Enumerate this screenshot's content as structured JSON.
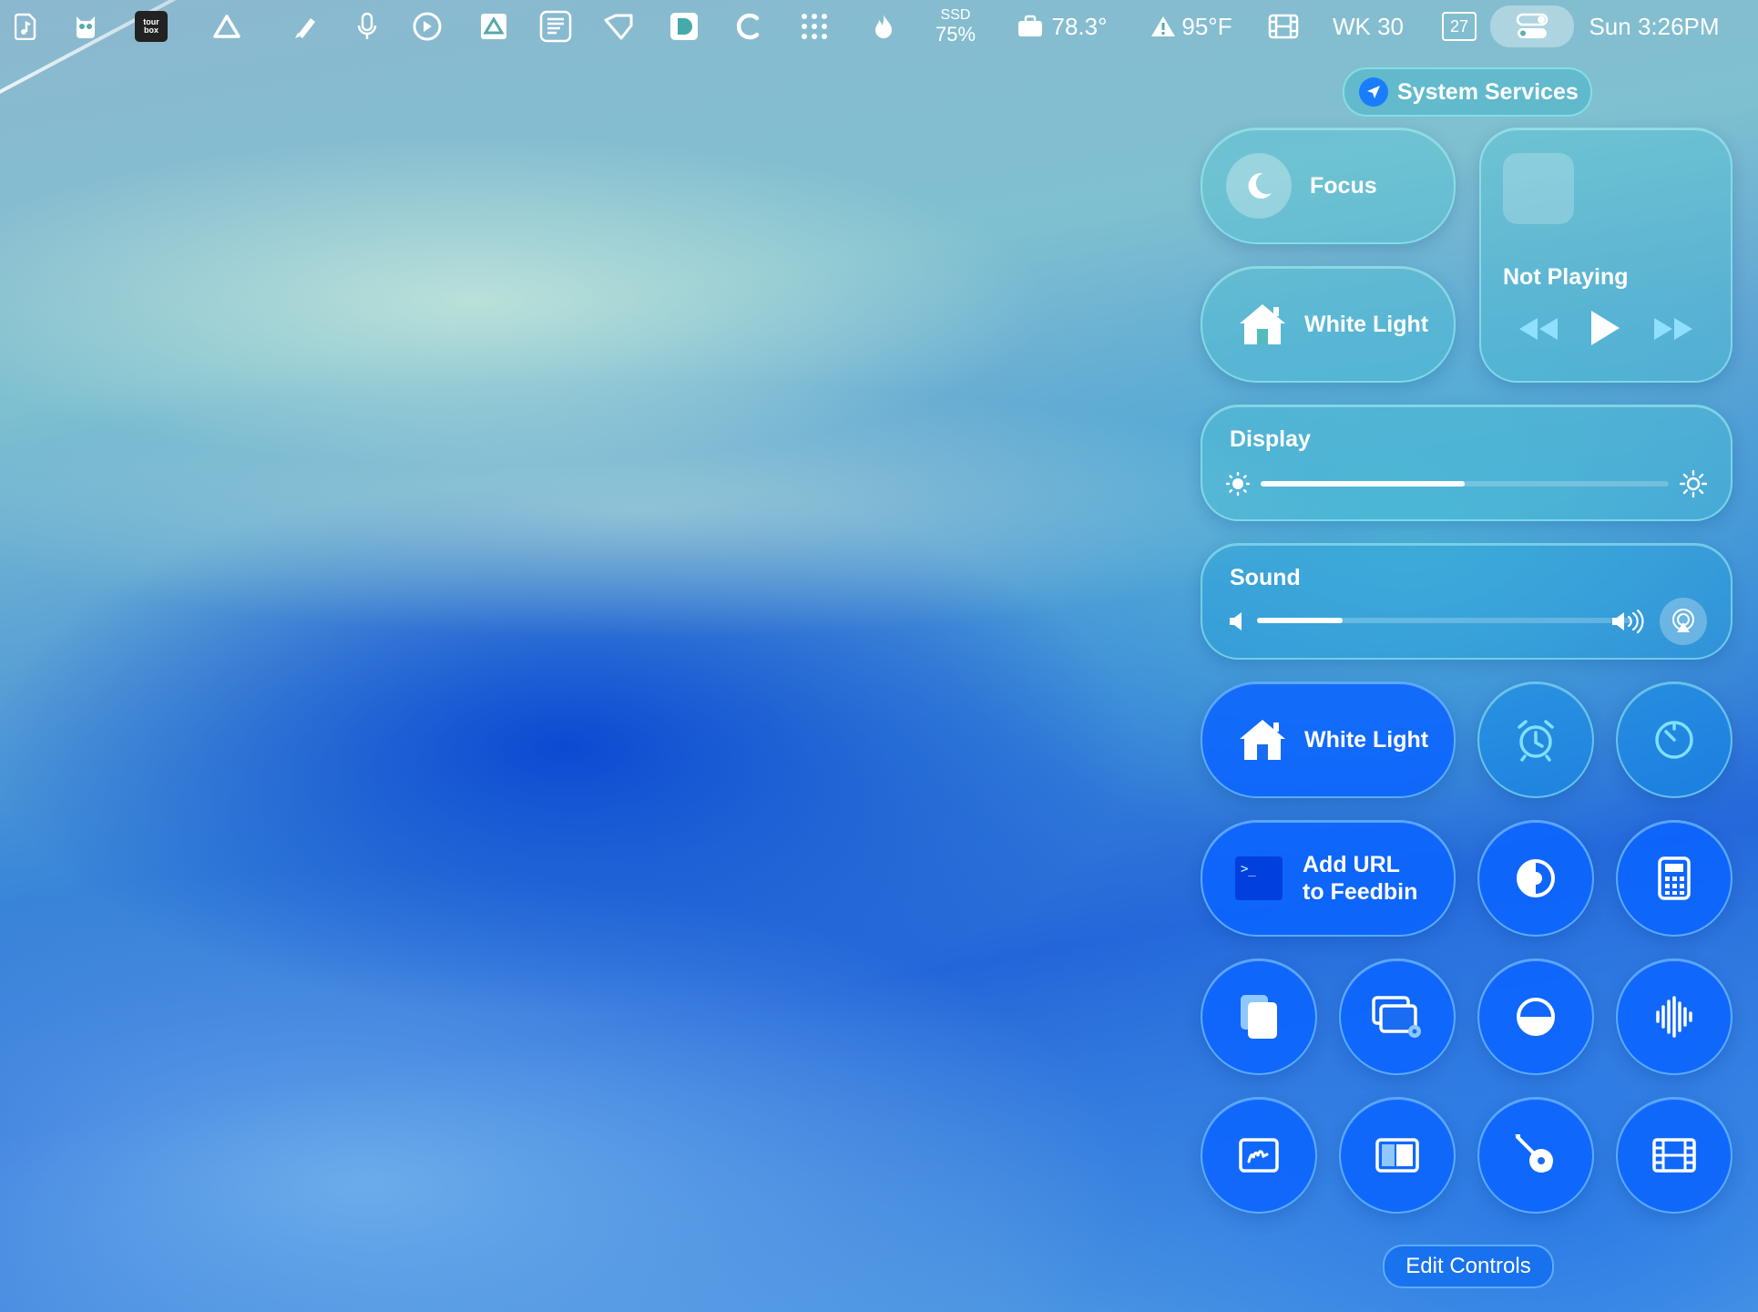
{
  "menubar": {
    "ssd_label": "SSD",
    "ssd_value": "75%",
    "cpu_temp": "78.3°",
    "weather": "95°F",
    "week": "WK 30",
    "date_day": "27",
    "clock": "Sun 3:26PM"
  },
  "control_center": {
    "system_services": "System Services",
    "focus_label": "Focus",
    "now_playing_label": "Not Playing",
    "home_light_1": "White Light",
    "display_label": "Display",
    "display_brightness": 0.5,
    "sound_label": "Sound",
    "sound_volume": 0.23,
    "home_light_2": "White Light",
    "feedbin_line1": "Add URL",
    "feedbin_line2": "to Feedbin",
    "edit_controls": "Edit Controls"
  },
  "icons": [
    "music-note-icon",
    "owl-icon",
    "tourbox-icon",
    "triangle-icon",
    "pen-icon",
    "microphone-icon",
    "timing-icon",
    "drive-icon",
    "text-icon",
    "tag-icon",
    "d-icon",
    "c-icon",
    "dots-grid-icon",
    "flame-icon",
    "briefcase-icon",
    "warning-icon",
    "film-icon",
    "calendar-icon",
    "control-center-icon",
    "moon-icon",
    "home-icon",
    "rewind-icon",
    "play-icon",
    "fast-forward-icon",
    "brightness-low-icon",
    "brightness-high-icon",
    "volume-low-icon",
    "volume-high-icon",
    "airplay-icon",
    "alarm-icon",
    "timer-icon",
    "terminal-icon",
    "dark-mode-icon",
    "calculator-icon",
    "copy-icon",
    "screen-settings-icon",
    "half-circle-icon",
    "waveform-icon",
    "markup-icon",
    "sidebar-icon",
    "guitar-icon",
    "film-strip-icon"
  ]
}
